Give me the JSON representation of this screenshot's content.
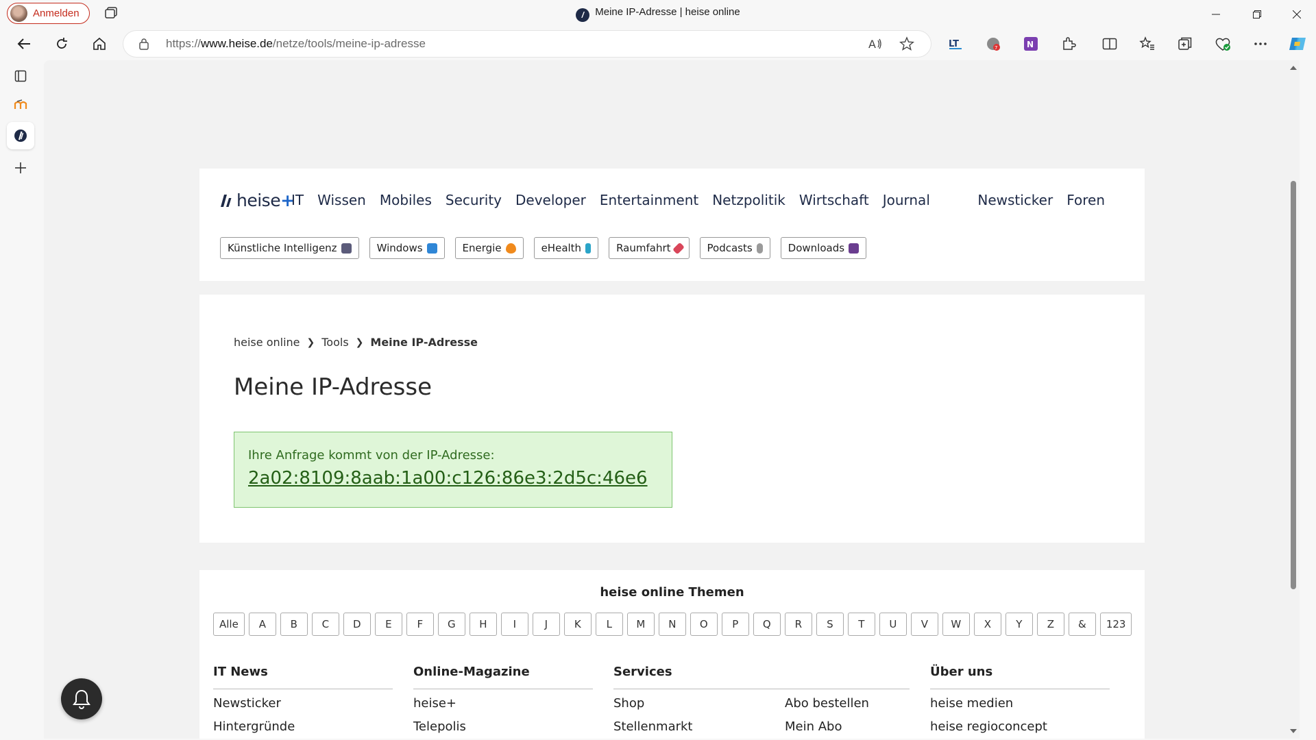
{
  "browser": {
    "profile_label": "Anmelden",
    "tab_title": "Meine IP-Adresse | heise online",
    "url_prefix": "https://",
    "url_domain": "www.heise.de",
    "url_path": "/netze/tools/meine-ip-adresse"
  },
  "nav": {
    "logo_text": "heise",
    "logo_plus": "+",
    "main": [
      "IT",
      "Wissen",
      "Mobiles",
      "Security",
      "Developer",
      "Entertainment",
      "Netzpolitik",
      "Wirtschaft",
      "Journal"
    ],
    "right": [
      "Newsticker",
      "Foren"
    ]
  },
  "chips": [
    {
      "label": "Künstliche Intelligenz",
      "color": "#5b5b7a"
    },
    {
      "label": "Windows",
      "color": "#2f86d6"
    },
    {
      "label": "Energie",
      "color": "#f08a1c"
    },
    {
      "label": "eHealth",
      "color": "#2aa4c8"
    },
    {
      "label": "Raumfahrt",
      "color": "#d9465a"
    },
    {
      "label": "Podcasts",
      "color": "#9a9a9a"
    },
    {
      "label": "Downloads",
      "color": "#6a3d8f"
    }
  ],
  "breadcrumb": {
    "items": [
      "heise online",
      "Tools"
    ],
    "current": "Meine IP-Adresse"
  },
  "page": {
    "title": "Meine IP-Adresse",
    "ip_label": "Ihre Anfrage kommt von der IP-Adresse:",
    "ip_value": "2a02:8109:8aab:1a00:c126:86e3:2d5c:46e6"
  },
  "themen": {
    "title": "heise online Themen",
    "letters": [
      "Alle",
      "A",
      "B",
      "C",
      "D",
      "E",
      "F",
      "G",
      "H",
      "I",
      "J",
      "K",
      "L",
      "M",
      "N",
      "O",
      "P",
      "Q",
      "R",
      "S",
      "T",
      "U",
      "V",
      "W",
      "X",
      "Y",
      "Z",
      "&",
      "123"
    ]
  },
  "footer": {
    "it_news": {
      "title": "IT News",
      "links": [
        "Newsticker",
        "Hintergründe"
      ]
    },
    "online_magazine": {
      "title": "Online-Magazine",
      "links": [
        "heise+",
        "Telepolis"
      ]
    },
    "services": {
      "title": "Services",
      "links_a": [
        "Shop",
        "Stellenmarkt"
      ],
      "links_b": [
        "Abo bestellen",
        "Mein Abo"
      ]
    },
    "ueber_uns": {
      "title": "Über uns",
      "links": [
        "heise medien",
        "heise regioconcept"
      ]
    }
  },
  "colors": {
    "accent": "#c42b1c",
    "brand": "#1e2a47",
    "success_bg": "#dff6d8",
    "success_text": "#245f16"
  }
}
